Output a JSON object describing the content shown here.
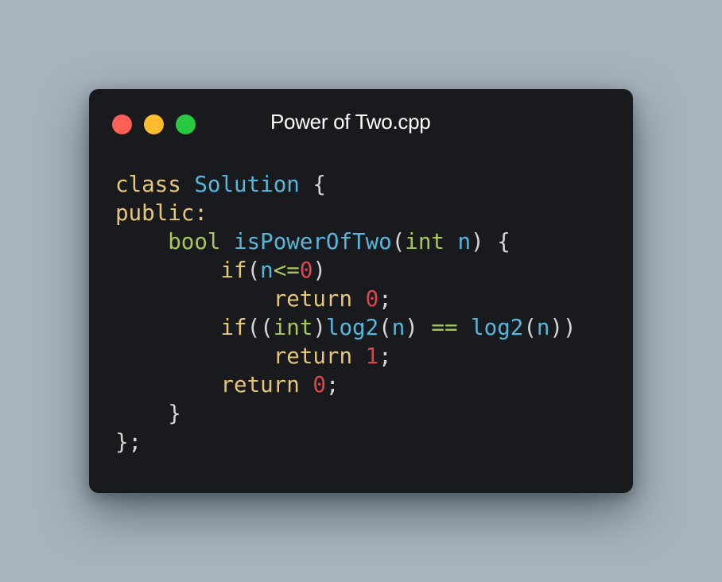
{
  "window": {
    "title": "Power of Two.cpp",
    "controls": {
      "close_color": "#fe5f57",
      "minimize_color": "#febc2e",
      "maximize_color": "#28c840"
    }
  },
  "code": {
    "language": "cpp",
    "lines": [
      [
        {
          "t": "class",
          "k": "kw"
        },
        {
          "t": " ",
          "k": "punc"
        },
        {
          "t": "Solution",
          "k": "cls"
        },
        {
          "t": " {",
          "k": "punc"
        }
      ],
      [
        {
          "t": "public:",
          "k": "kw"
        }
      ],
      [
        {
          "t": "    ",
          "k": "punc"
        },
        {
          "t": "bool",
          "k": "type"
        },
        {
          "t": " ",
          "k": "punc"
        },
        {
          "t": "isPowerOfTwo",
          "k": "fn"
        },
        {
          "t": "(",
          "k": "punc"
        },
        {
          "t": "int",
          "k": "type"
        },
        {
          "t": " ",
          "k": "punc"
        },
        {
          "t": "n",
          "k": "var"
        },
        {
          "t": ") {",
          "k": "punc"
        }
      ],
      [
        {
          "t": "        ",
          "k": "punc"
        },
        {
          "t": "if",
          "k": "kw"
        },
        {
          "t": "(",
          "k": "punc"
        },
        {
          "t": "n",
          "k": "var"
        },
        {
          "t": "<=",
          "k": "op"
        },
        {
          "t": "0",
          "k": "num"
        },
        {
          "t": ")",
          "k": "punc"
        }
      ],
      [
        {
          "t": "            ",
          "k": "punc"
        },
        {
          "t": "return",
          "k": "kw"
        },
        {
          "t": " ",
          "k": "punc"
        },
        {
          "t": "0",
          "k": "num"
        },
        {
          "t": ";",
          "k": "punc"
        }
      ],
      [
        {
          "t": "        ",
          "k": "punc"
        },
        {
          "t": "if",
          "k": "kw"
        },
        {
          "t": "((",
          "k": "punc"
        },
        {
          "t": "int",
          "k": "type"
        },
        {
          "t": ")",
          "k": "punc"
        },
        {
          "t": "log2",
          "k": "fn"
        },
        {
          "t": "(",
          "k": "punc"
        },
        {
          "t": "n",
          "k": "var"
        },
        {
          "t": ") ",
          "k": "punc"
        },
        {
          "t": "==",
          "k": "op"
        },
        {
          "t": " ",
          "k": "punc"
        },
        {
          "t": "log2",
          "k": "fn"
        },
        {
          "t": "(",
          "k": "punc"
        },
        {
          "t": "n",
          "k": "var"
        },
        {
          "t": "))",
          "k": "punc"
        }
      ],
      [
        {
          "t": "            ",
          "k": "punc"
        },
        {
          "t": "return",
          "k": "kw"
        },
        {
          "t": " ",
          "k": "punc"
        },
        {
          "t": "1",
          "k": "num"
        },
        {
          "t": ";",
          "k": "punc"
        }
      ],
      [
        {
          "t": "        ",
          "k": "punc"
        },
        {
          "t": "return",
          "k": "kw"
        },
        {
          "t": " ",
          "k": "punc"
        },
        {
          "t": "0",
          "k": "num"
        },
        {
          "t": ";",
          "k": "punc"
        }
      ],
      [
        {
          "t": "    }",
          "k": "punc"
        }
      ],
      [
        {
          "t": "};",
          "k": "punc"
        }
      ]
    ]
  }
}
